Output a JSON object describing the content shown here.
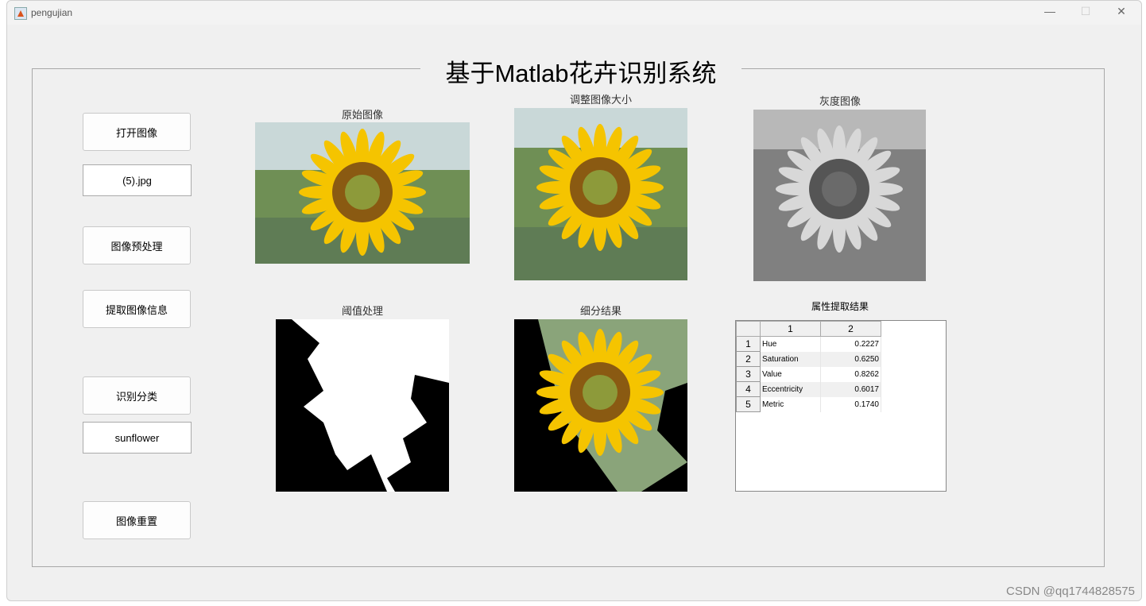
{
  "window": {
    "title": "pengujian",
    "minimize": "—",
    "maximize": "☐",
    "close": "✕"
  },
  "heading": "基于Matlab花卉识别系统",
  "buttons": {
    "open": "打开图像",
    "preprocess": "图像预处理",
    "extract": "提取图像信息",
    "classify": "识别分类",
    "reset": "图像重置"
  },
  "fields": {
    "filename": "(5).jpg",
    "result": "sunflower"
  },
  "captions": {
    "original": "原始图像",
    "resized": "调整图像大小",
    "gray": "灰度图像",
    "threshold": "阈值处理",
    "segmented": "细分结果",
    "table": "属性提取结果"
  },
  "table": {
    "columns": [
      "1",
      "2"
    ],
    "rows": [
      {
        "n": "1",
        "name": "Hue",
        "value": "0.2227"
      },
      {
        "n": "2",
        "name": "Saturation",
        "value": "0.6250"
      },
      {
        "n": "3",
        "name": "Value",
        "value": "0.8262"
      },
      {
        "n": "4",
        "name": "Eccentricity",
        "value": "0.6017"
      },
      {
        "n": "5",
        "name": "Metric",
        "value": "0.1740"
      }
    ]
  },
  "watermark": "CSDN @qq1744828575"
}
